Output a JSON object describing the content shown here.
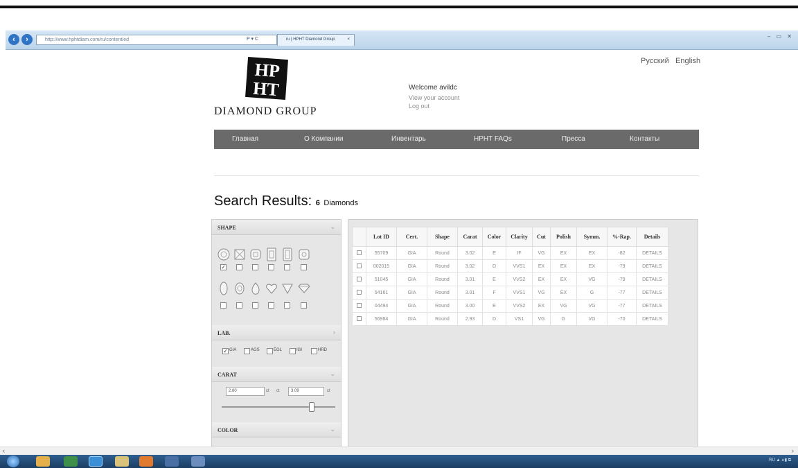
{
  "browser": {
    "address": "http://www.hphtdiam.com/ru/content/ed",
    "address_controls": "P ▾ C",
    "tab_title": "ru | HPHT Diamond Group",
    "tab_close": "×",
    "window_controls": "– ▭ ✕"
  },
  "lang": {
    "ru": "Русский",
    "en": "English"
  },
  "logo": {
    "mark": "HPHT",
    "text": "DIAMOND GROUP"
  },
  "user": {
    "welcome": "Welcome avildc",
    "view_account": "View your account",
    "logout": "Log out"
  },
  "menu": [
    "Главная",
    "О Компании",
    "Инвентарь",
    "HPHT FAQs",
    "Пресса",
    "Контакты"
  ],
  "search": {
    "title": "Search Results:",
    "count": "6",
    "unit": "Diamonds"
  },
  "filters": {
    "shape": {
      "label": "SHAPE",
      "selected": [
        "round"
      ]
    },
    "lab": {
      "label": "LAB.",
      "options": [
        "GIA",
        "AGS",
        "EGL",
        "IGI",
        "HRD"
      ],
      "checked": [
        "GIA"
      ]
    },
    "carat": {
      "label": "CARAT",
      "from": "2.80",
      "from_label": "ct",
      "to_label": "ct",
      "to": "3.09",
      "to_unit": "ct"
    },
    "color": {
      "label": "COLOR"
    }
  },
  "table": {
    "headers": [
      "",
      "Lot ID",
      "Cert.",
      "Shape",
      "Carat",
      "Color",
      "Clarity",
      "Cut",
      "Polish",
      "Symm.",
      "%-Rap.",
      "Details"
    ],
    "rows": [
      [
        "55709",
        "GIA",
        "Round",
        "3.02",
        "E",
        "IF",
        "VG",
        "EX",
        "EX",
        "-82",
        "DETAILS"
      ],
      [
        "002015",
        "GIA",
        "Round",
        "3.02",
        "D",
        "VVS1",
        "EX",
        "EX",
        "EX",
        "-79",
        "DETAILS"
      ],
      [
        "51045",
        "GIA",
        "Round",
        "3.01",
        "E",
        "VVS2",
        "EX",
        "EX",
        "VG",
        "-79",
        "DETAILS"
      ],
      [
        "54161",
        "GIA",
        "Round",
        "3.01",
        "F",
        "VVS1",
        "VG",
        "EX",
        "G",
        "-77",
        "DETAILS"
      ],
      [
        "04494",
        "GIA",
        "Round",
        "3.00",
        "E",
        "VVS2",
        "EX",
        "VG",
        "VG",
        "-77",
        "DETAILS"
      ],
      [
        "56984",
        "GIA",
        "Round",
        "2.93",
        "D",
        "VS1",
        "VG",
        "G",
        "VG",
        "-70",
        "DETAILS"
      ]
    ]
  },
  "taskbar": {
    "tray": "RU ▲ ◂ ▮ ⧉"
  },
  "colors": {
    "menubar": "#6a6a6a",
    "link": "#4f7ec9",
    "taskbar": "#2f5e8f"
  }
}
